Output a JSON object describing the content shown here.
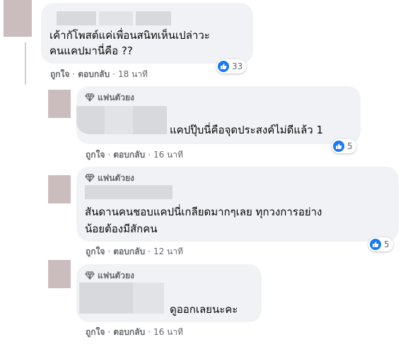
{
  "comments": [
    {
      "text_lines": [
        "เค้ากัโพสต์แค่เพื่อนสนิทเห็นเปล่าวะ",
        "คนแคปมานี่คือ ??"
      ],
      "actions": {
        "like": "ถูกใจ",
        "reply": "ตอบกลับ",
        "time": "18 นาที"
      },
      "reactions": "33"
    },
    {
      "badge": "แฟนตัวยง",
      "text_lines": [
        "แคปปุ๊บนี่คือจุดประสงค์ไม่ดีแล้ว 1"
      ],
      "actions": {
        "like": "ถูกใจ",
        "reply": "ตอบกลับ",
        "time": "16 นาที"
      },
      "reactions": "5"
    },
    {
      "badge": "แฟนตัวยง",
      "text_lines": [
        "สันดานคนชอบแคปนี่เกลียดมากๆเลย ทุกวงการอย่าง",
        "น้อยต้องมีสักคน"
      ],
      "actions": {
        "like": "ถูกใจ",
        "reply": "ตอบกลับ",
        "time": "12 นาที"
      },
      "reactions": "5"
    },
    {
      "badge": "แฟนตัวยง",
      "text_lines": [
        "ดูออกเลยนะคะ"
      ],
      "actions": {
        "like": "ถูกใจ",
        "reply": "ตอบกลับ",
        "time": "16 นาที"
      },
      "reactions": ""
    }
  ],
  "icons": {
    "badge": "diamond-icon",
    "reaction": "like-icon"
  },
  "colors": {
    "bubble": "#f0f2f5",
    "meta": "#65676b",
    "like": "#1877f2",
    "avatar": "#cbbcbe"
  }
}
